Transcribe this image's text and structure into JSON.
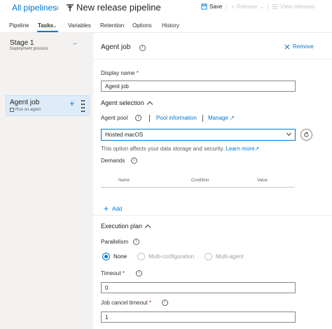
{
  "header": {
    "breadcrumb_root": "All pipelines",
    "separator": "›",
    "pipeline_title": "New release pipeline",
    "pipeline_icon": "release-pipeline-icon",
    "save_label": "Save",
    "release_label": "Release",
    "view_releases_label": "View releases"
  },
  "tabs": [
    {
      "label": "Pipeline"
    },
    {
      "label": "Tasks",
      "active": true
    },
    {
      "label": "Variables"
    },
    {
      "label": "Retention"
    },
    {
      "label": "Options"
    },
    {
      "label": "History"
    }
  ],
  "stage": {
    "title": "Stage 1",
    "subtitle": "Deployment process",
    "more": "..."
  },
  "job": {
    "title": "Agent job",
    "subtitle": "Run on agent",
    "add": "+"
  },
  "panel": {
    "title": "Agent job",
    "remove_label": "Remove",
    "display_name_label": "Display name",
    "display_name_value": "Agent job",
    "agent_selection_label": "Agent selection",
    "agent_pool_label": "Agent pool",
    "pool_information_link": "Pool information",
    "manage_link": "Manage",
    "agent_pool_value": "Hosted macOS",
    "storage_note": "This option affects your data storage and security.",
    "learn_more_link": "Learn more",
    "demands_label": "Demands",
    "demands_columns": [
      "Name",
      "Condition",
      "Value"
    ],
    "add_label": "Add",
    "execution_plan_label": "Execution plan",
    "parallelism_label": "Parallelism",
    "parallelism_options": [
      "None",
      "Multi-configuration",
      "Multi-agent"
    ],
    "parallelism_selected": "None",
    "timeout_label": "Timeout",
    "timeout_value": "0",
    "cancel_timeout_label": "Job cancel timeout",
    "cancel_timeout_value": "1",
    "required_mark": "*"
  },
  "colors": {
    "accent": "#0078d4",
    "left_panel_bg": "#f3f2f1",
    "selected_job_bg": "#deecf9"
  }
}
